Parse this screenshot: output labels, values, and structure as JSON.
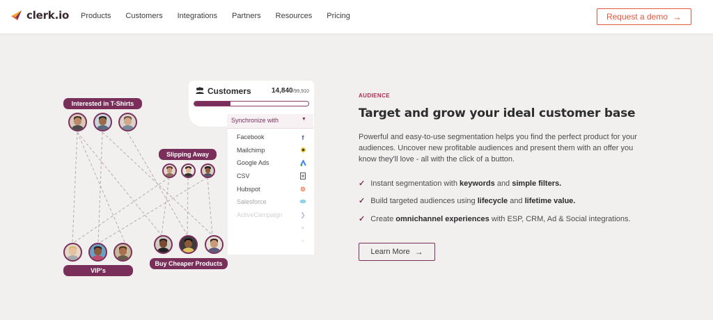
{
  "nav": {
    "logo_text": "clerk.io",
    "links": [
      "Products",
      "Customers",
      "Integrations",
      "Partners",
      "Resources",
      "Pricing"
    ],
    "demo_label": "Request a demo",
    "accent": "#e0583c"
  },
  "illustration": {
    "segments": {
      "tshirts": "Interested in T-Shirts",
      "slipping": "Slipping Away",
      "vips": "VIP's",
      "cheaper": "Buy Cheaper Products"
    },
    "customers_title": "Customers",
    "count": "14,840",
    "total": "/99,910",
    "progress": 0.32,
    "sync_label": "Synchronize with",
    "sync_items": [
      "Facebook",
      "Mailchimp",
      "Google Ads",
      "CSV",
      "Hubspot",
      "Salesforce",
      "ActiveCampaign"
    ],
    "brand_color": "#7a2f5a"
  },
  "content": {
    "eyebrow": "AUDIENCE",
    "headline": "Target and grow your ideal customer base",
    "description": "Powerful and easy-to-use segmentation helps you find the perfect product for your audiences. Uncover new profitable audiences and present them with an offer you know they'll love - all with the click of a button.",
    "bullets": [
      {
        "pre": "Instant segmentation with ",
        "b1": "keywords",
        "mid": " and ",
        "b2": "simple filters.",
        "post": ""
      },
      {
        "pre": "Build targeted audiences using ",
        "b1": "lifecycle",
        "mid": " and ",
        "b2": "lifetime value.",
        "post": ""
      },
      {
        "pre": "Create ",
        "b1": "omnichannel experiences",
        "mid": " with ESP, CRM, Ad & Social integrations.",
        "b2": "",
        "post": ""
      }
    ],
    "learn_more": "Learn More"
  }
}
